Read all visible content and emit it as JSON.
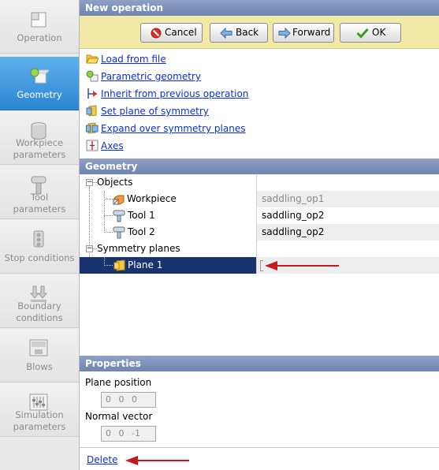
{
  "sidebar": {
    "items": [
      {
        "label_lines": [
          "Operation"
        ],
        "icon": "operation-icon",
        "active": false
      },
      {
        "label_lines": [
          "Geometry"
        ],
        "icon": "geometry-icon",
        "active": true
      },
      {
        "label_lines": [
          "Workpiece",
          "parameters"
        ],
        "icon": "workpiece-parameters-icon",
        "active": false
      },
      {
        "label_lines": [
          "Tool",
          "parameters"
        ],
        "icon": "tool-parameters-icon",
        "active": false
      },
      {
        "label_lines": [
          "Stop conditions"
        ],
        "icon": "stop-conditions-icon",
        "active": false
      },
      {
        "label_lines": [
          "Boundary",
          "conditions"
        ],
        "icon": "boundary-conditions-icon",
        "active": false
      },
      {
        "label_lines": [
          "Blows"
        ],
        "icon": "blows-icon",
        "active": false
      },
      {
        "label_lines": [
          "Simulation",
          "parameters"
        ],
        "icon": "simulation-parameters-icon",
        "active": false
      }
    ]
  },
  "header": {
    "title": "New operation"
  },
  "toolbar": {
    "cancel_label": "Cancel",
    "back_label": "Back",
    "forward_label": "Forward",
    "ok_label": "OK"
  },
  "actions": [
    {
      "label": "Load from file",
      "icon": "folder-open-icon"
    },
    {
      "label": "Parametric geometry",
      "icon": "parametric-geometry-icon"
    },
    {
      "label": "Inherit from previous operation",
      "icon": "inherit-icon"
    },
    {
      "label": "Set plane of symmetry",
      "icon": "symmetry-plane-icon"
    },
    {
      "label": "Expand over symmetry planes",
      "icon": "expand-symmetry-icon"
    },
    {
      "label": "Axes",
      "icon": "axes-icon"
    }
  ],
  "geometry": {
    "section_title": "Geometry",
    "tree": {
      "objects_label": "Objects",
      "workpiece": {
        "name": "Workpiece",
        "value": "saddling_op1"
      },
      "tool1": {
        "name": "Tool 1",
        "value": "saddling_op2"
      },
      "tool2": {
        "name": "Tool 2",
        "value": "saddling_op2"
      },
      "symmetry_label": "Symmetry planes",
      "plane1": {
        "name": "Plane 1",
        "value": ""
      }
    }
  },
  "properties": {
    "section_title": "Properties",
    "plane_position_label": "Plane position",
    "plane_position_value": "0  0  0",
    "normal_vector_label": "Normal vector",
    "normal_vector_value": "0  0  -1",
    "delete_label": "Delete"
  },
  "colors": {
    "accent": "#2a86d2",
    "annotation_arrow": "#c8191e",
    "link": "#0d2fd6",
    "selection": "#19336e"
  }
}
